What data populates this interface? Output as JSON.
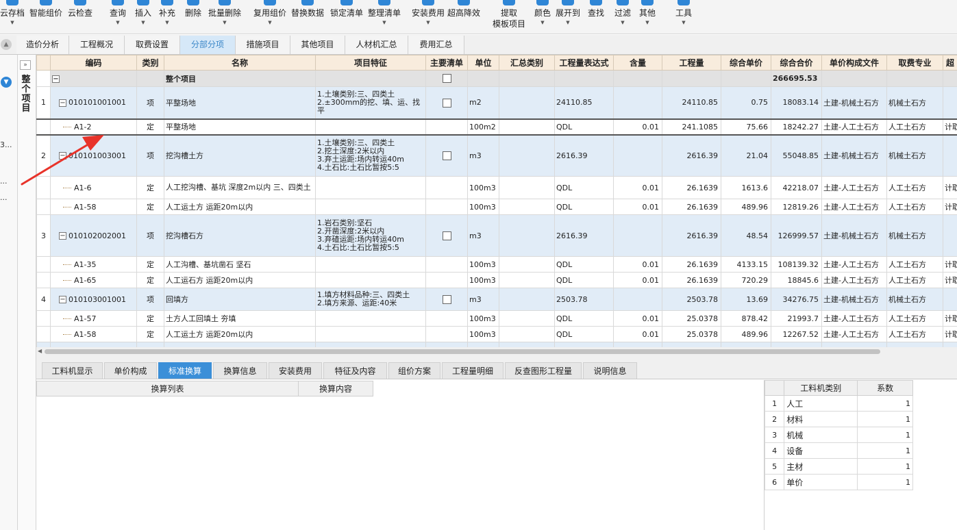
{
  "toolbar": {
    "buttons": [
      {
        "label": "云存档",
        "caret": true
      },
      {
        "label": "智能组价",
        "caret": false
      },
      {
        "label": "云检查",
        "caret": false
      },
      {
        "label": "查询",
        "caret": true
      },
      {
        "label": "插入",
        "caret": true
      },
      {
        "label": "补充",
        "caret": true
      },
      {
        "label": "删除",
        "caret": false
      },
      {
        "label": "批量删除",
        "caret": true
      },
      {
        "label": "复用组价",
        "caret": true
      },
      {
        "label": "替换数据",
        "caret": false
      },
      {
        "label": "锁定清单",
        "caret": false
      },
      {
        "label": "整理清单",
        "caret": true
      },
      {
        "label": "安装费用",
        "caret": true
      },
      {
        "label": "超高降效",
        "caret": false
      },
      {
        "label": "提取",
        "label2": "模板项目",
        "caret": false
      },
      {
        "label": "颜色",
        "caret": true
      },
      {
        "label": "展开到",
        "caret": true
      },
      {
        "label": "查找",
        "caret": false
      },
      {
        "label": "过滤",
        "caret": true
      },
      {
        "label": "其他",
        "caret": true
      },
      {
        "label": "工具",
        "caret": true
      }
    ]
  },
  "tabs": [
    "造价分析",
    "工程概况",
    "取费设置",
    "分部分项",
    "措施项目",
    "其他项目",
    "人材机汇总",
    "费用汇总"
  ],
  "active_tab": "分部分项",
  "left": {
    "truncated": [
      "3...",
      "...",
      "..."
    ]
  },
  "vertical_label": "整个项目",
  "grid": {
    "columns": [
      "编码",
      "类别",
      "名称",
      "项目特征",
      "主要清单",
      "单位",
      "汇总类别",
      "工程量表达式",
      "含量",
      "工程量",
      "综合单价",
      "综合合价",
      "单价构成文件",
      "取费专业",
      "超"
    ],
    "root": {
      "name": "整个项目",
      "total": "266695.53"
    },
    "rows": [
      {
        "type": "item",
        "num": "1",
        "code": "010101001001",
        "cat": "项",
        "name": "平整场地",
        "feature": "1.土壤类别:三、四类土\n2.±300mm的挖、填、运、找平",
        "unit": "m2",
        "sumcat": "",
        "expr": "24110.85",
        "content": "",
        "qty": "24110.85",
        "price": "0.75",
        "total": "18083.14",
        "file": "土建-机械土石方",
        "major": "机械土石方",
        "extra": ""
      },
      {
        "type": "sub",
        "selected": true,
        "num": "",
        "code": "A1-2",
        "cat": "定",
        "name": "平整场地",
        "feature": "",
        "unit": "100m2",
        "sumcat": "",
        "expr": "QDL",
        "content": "0.01",
        "qty": "241.1085",
        "price": "75.66",
        "total": "18242.27",
        "file": "土建-人工土石方",
        "major": "人工土石方",
        "extra": "计取"
      },
      {
        "type": "item",
        "num": "2",
        "code": "010101003001",
        "cat": "项",
        "name": "挖沟槽土方",
        "feature": "1.土壤类别:三、四类土\n2.挖土深度:2米以内\n3.弃土运距:场内转运40m\n4.土石比:土石比暂按5:5",
        "unit": "m3",
        "sumcat": "",
        "expr": "2616.39",
        "content": "",
        "qty": "2616.39",
        "price": "21.04",
        "total": "55048.85",
        "file": "土建-机械土石方",
        "major": "机械土石方",
        "extra": ""
      },
      {
        "type": "sub",
        "num": "",
        "code": "A1-6",
        "cat": "定",
        "name": "人工挖沟槽、基坑 深度2m以内 三、四类土",
        "feature": "",
        "unit": "100m3",
        "sumcat": "",
        "expr": "QDL",
        "content": "0.01",
        "qty": "26.1639",
        "price": "1613.6",
        "total": "42218.07",
        "file": "土建-人工土石方",
        "major": "人工土石方",
        "extra": "计取"
      },
      {
        "type": "sub",
        "num": "",
        "code": "A1-58",
        "cat": "定",
        "name": "人工运土方 运距20m以内",
        "feature": "",
        "unit": "100m3",
        "sumcat": "",
        "expr": "QDL",
        "content": "0.01",
        "qty": "26.1639",
        "price": "489.96",
        "total": "12819.26",
        "file": "土建-人工土石方",
        "major": "人工土石方",
        "extra": "计取"
      },
      {
        "type": "item",
        "num": "3",
        "code": "010102002001",
        "cat": "项",
        "name": "挖沟槽石方",
        "feature": "1.岩石类别:坚石\n2.开凿深度:2米以内\n3.弃碴运距:场内转运40m\n4.土石比:土石比暂按5:5",
        "unit": "m3",
        "sumcat": "",
        "expr": "2616.39",
        "content": "",
        "qty": "2616.39",
        "price": "48.54",
        "total": "126999.57",
        "file": "土建-机械土石方",
        "major": "机械土石方",
        "extra": ""
      },
      {
        "type": "sub",
        "num": "",
        "code": "A1-35",
        "cat": "定",
        "name": "人工沟槽、基坑凿石 坚石",
        "feature": "",
        "unit": "100m3",
        "sumcat": "",
        "expr": "QDL",
        "content": "0.01",
        "qty": "26.1639",
        "price": "4133.15",
        "total": "108139.32",
        "file": "土建-人工土石方",
        "major": "人工土石方",
        "extra": "计取"
      },
      {
        "type": "sub",
        "num": "",
        "code": "A1-65",
        "cat": "定",
        "name": "人工运石方 运距20m以内",
        "feature": "",
        "unit": "100m3",
        "sumcat": "",
        "expr": "QDL",
        "content": "0.01",
        "qty": "26.1639",
        "price": "720.29",
        "total": "18845.6",
        "file": "土建-人工土石方",
        "major": "人工土石方",
        "extra": "计取"
      },
      {
        "type": "item",
        "num": "4",
        "code": "010103001001",
        "cat": "项",
        "name": "回填方",
        "feature": "1.填方材料品种:三、四类土\n2.填方来源、运距:40米",
        "unit": "m3",
        "sumcat": "",
        "expr": "2503.78",
        "content": "",
        "qty": "2503.78",
        "price": "13.69",
        "total": "34276.75",
        "file": "土建-机械土石方",
        "major": "机械土石方",
        "extra": ""
      },
      {
        "type": "sub",
        "num": "",
        "code": "A1-57",
        "cat": "定",
        "name": "土方人工回填土 夯填",
        "feature": "",
        "unit": "100m3",
        "sumcat": "",
        "expr": "QDL",
        "content": "0.01",
        "qty": "25.0378",
        "price": "878.42",
        "total": "21993.7",
        "file": "土建-人工土石方",
        "major": "人工土石方",
        "extra": "计取"
      },
      {
        "type": "sub",
        "num": "",
        "code": "A1-58",
        "cat": "定",
        "name": "人工运土方 运距20m以内",
        "feature": "",
        "unit": "100m3",
        "sumcat": "",
        "expr": "QDL",
        "content": "0.01",
        "qty": "25.0378",
        "price": "489.96",
        "total": "12267.52",
        "file": "土建-人工土石方",
        "major": "人工土石方",
        "extra": "计取"
      }
    ]
  },
  "bottom_tabs": [
    "工料机显示",
    "单价构成",
    "标准换算",
    "换算信息",
    "安装费用",
    "特征及内容",
    "组价方案",
    "工程量明细",
    "反查图形工程量",
    "说明信息"
  ],
  "active_bottom_tab": "标准换算",
  "conversion": {
    "list_header": "换算列表",
    "content_header": "换算内容"
  },
  "factor_table": {
    "headers": [
      "工料机类别",
      "系数"
    ],
    "rows": [
      {
        "idx": "1",
        "name": "人工",
        "value": "1"
      },
      {
        "idx": "2",
        "name": "材料",
        "value": "1"
      },
      {
        "idx": "3",
        "name": "机械",
        "value": "1"
      },
      {
        "idx": "4",
        "name": "设备",
        "value": "1"
      },
      {
        "idx": "5",
        "name": "主材",
        "value": "1"
      },
      {
        "idx": "6",
        "name": "单价",
        "value": "1"
      }
    ]
  },
  "colors": {
    "accent": "#3b8fd8",
    "header_bg": "#f8ecdd",
    "item_row_bg": "#e1ecf7",
    "arrow": "#e8332a"
  }
}
